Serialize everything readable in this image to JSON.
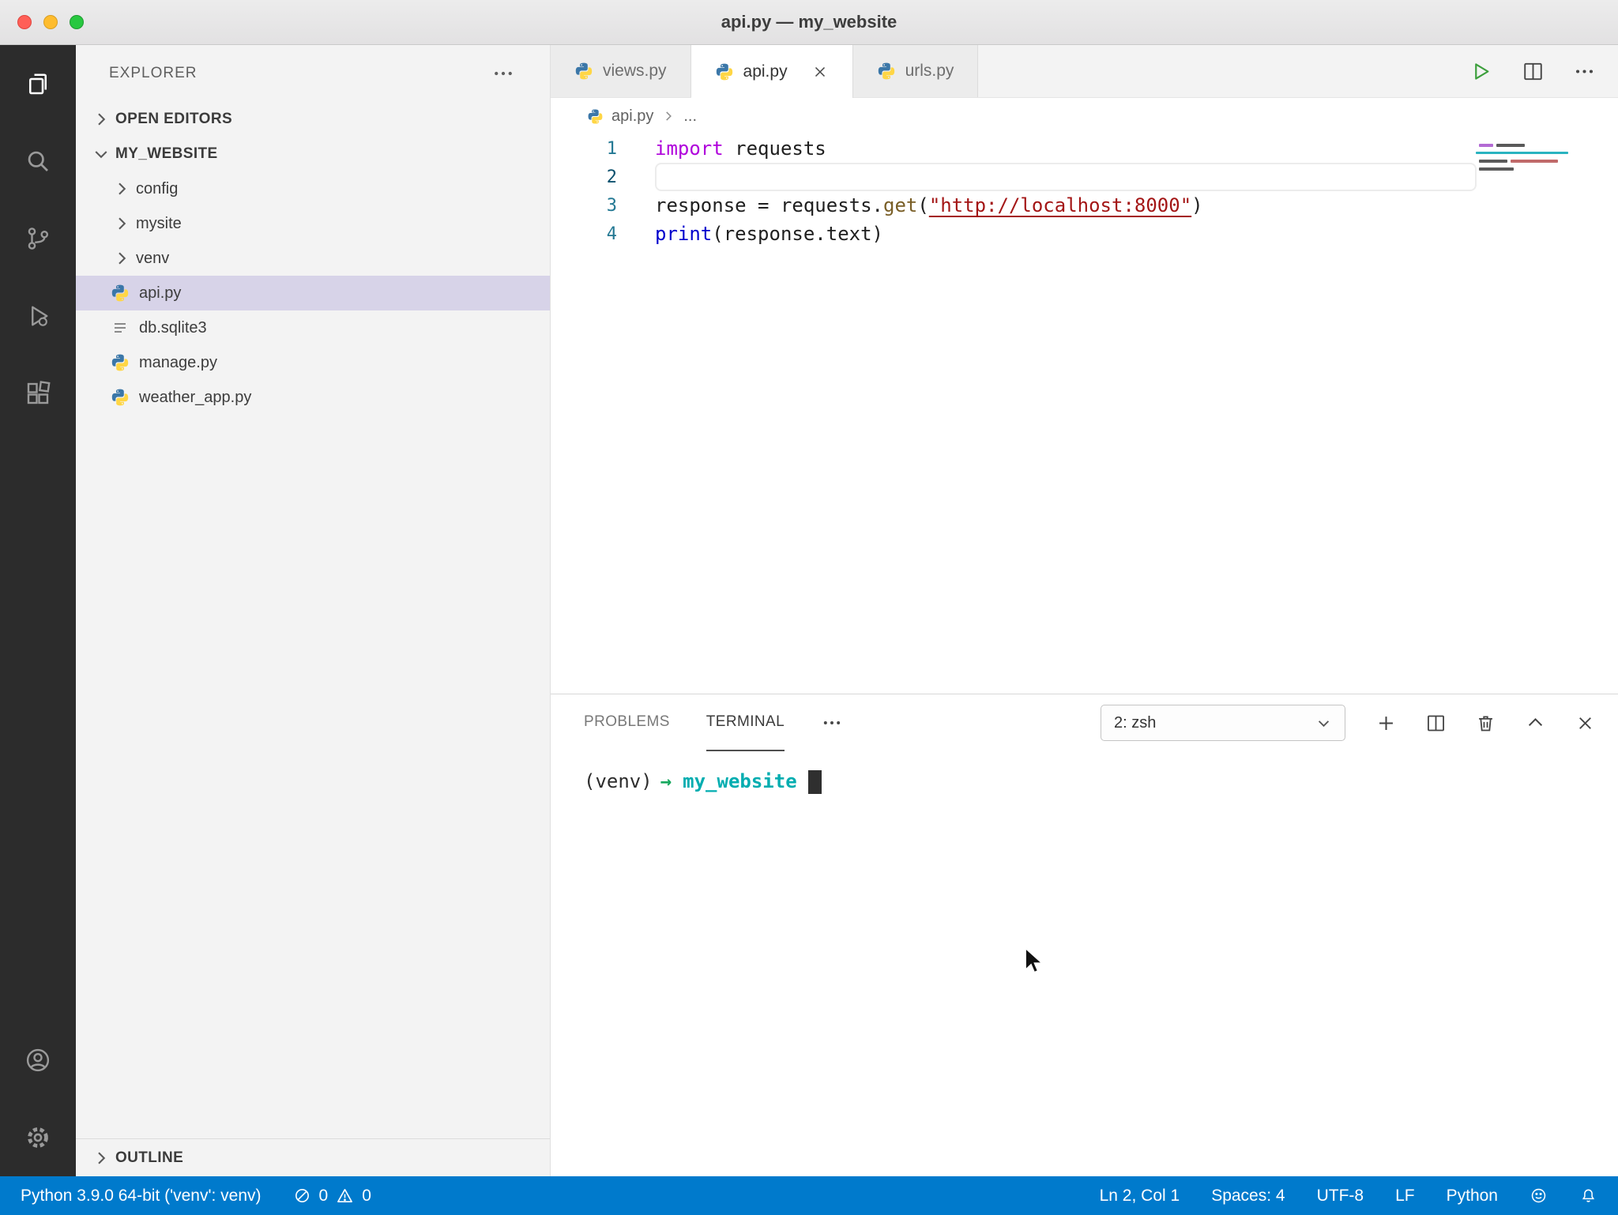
{
  "window": {
    "title": "api.py — my_website"
  },
  "sidebar": {
    "title": "EXPLORER",
    "open_editors": "OPEN EDITORS",
    "root": "MY_WEBSITE",
    "outline": "OUTLINE",
    "tree": [
      {
        "label": "config"
      },
      {
        "label": "mysite"
      },
      {
        "label": "venv"
      },
      {
        "label": "api.py"
      },
      {
        "label": "db.sqlite3"
      },
      {
        "label": "manage.py"
      },
      {
        "label": "weather_app.py"
      }
    ]
  },
  "tabs": [
    {
      "label": "views.py"
    },
    {
      "label": "api.py"
    },
    {
      "label": "urls.py"
    }
  ],
  "breadcrumb": {
    "file": "api.py",
    "more": "..."
  },
  "code": {
    "line_numbers": [
      "1",
      "2",
      "3",
      "4"
    ],
    "tokens": {
      "l1_kw": "import",
      "l1_rest": " requests",
      "l3_a": "response ",
      "l3_b": "= ",
      "l3_c": "requests.",
      "l3_d": "get",
      "l3_e": "(",
      "l3_f": "\"http://localhost:8000\"",
      "l3_g": ")",
      "l4_a": "print",
      "l4_b": "(response.text)"
    }
  },
  "panel": {
    "problems": "PROBLEMS",
    "terminal": "TERMINAL",
    "shell_select": "2: zsh"
  },
  "terminal_prompt": {
    "venv": "(venv)",
    "arrow": "→",
    "cwd": "my_website"
  },
  "status_bar": {
    "python_version": "Python 3.9.0 64-bit ('venv': venv)",
    "errors": "0",
    "warnings": "0",
    "cursor_position": "Ln 2, Col 1",
    "indentation": "Spaces: 4",
    "encoding": "UTF-8",
    "eol": "LF",
    "language": "Python"
  },
  "colors": {
    "status_bar": "#007acc",
    "activity_bar": "#2c2c2c",
    "selection_highlight": "#d7d3e8",
    "keyword": "#af00db",
    "string": "#a31515",
    "terminal_dir": "#00adb0",
    "terminal_arrow": "#17a85e"
  }
}
